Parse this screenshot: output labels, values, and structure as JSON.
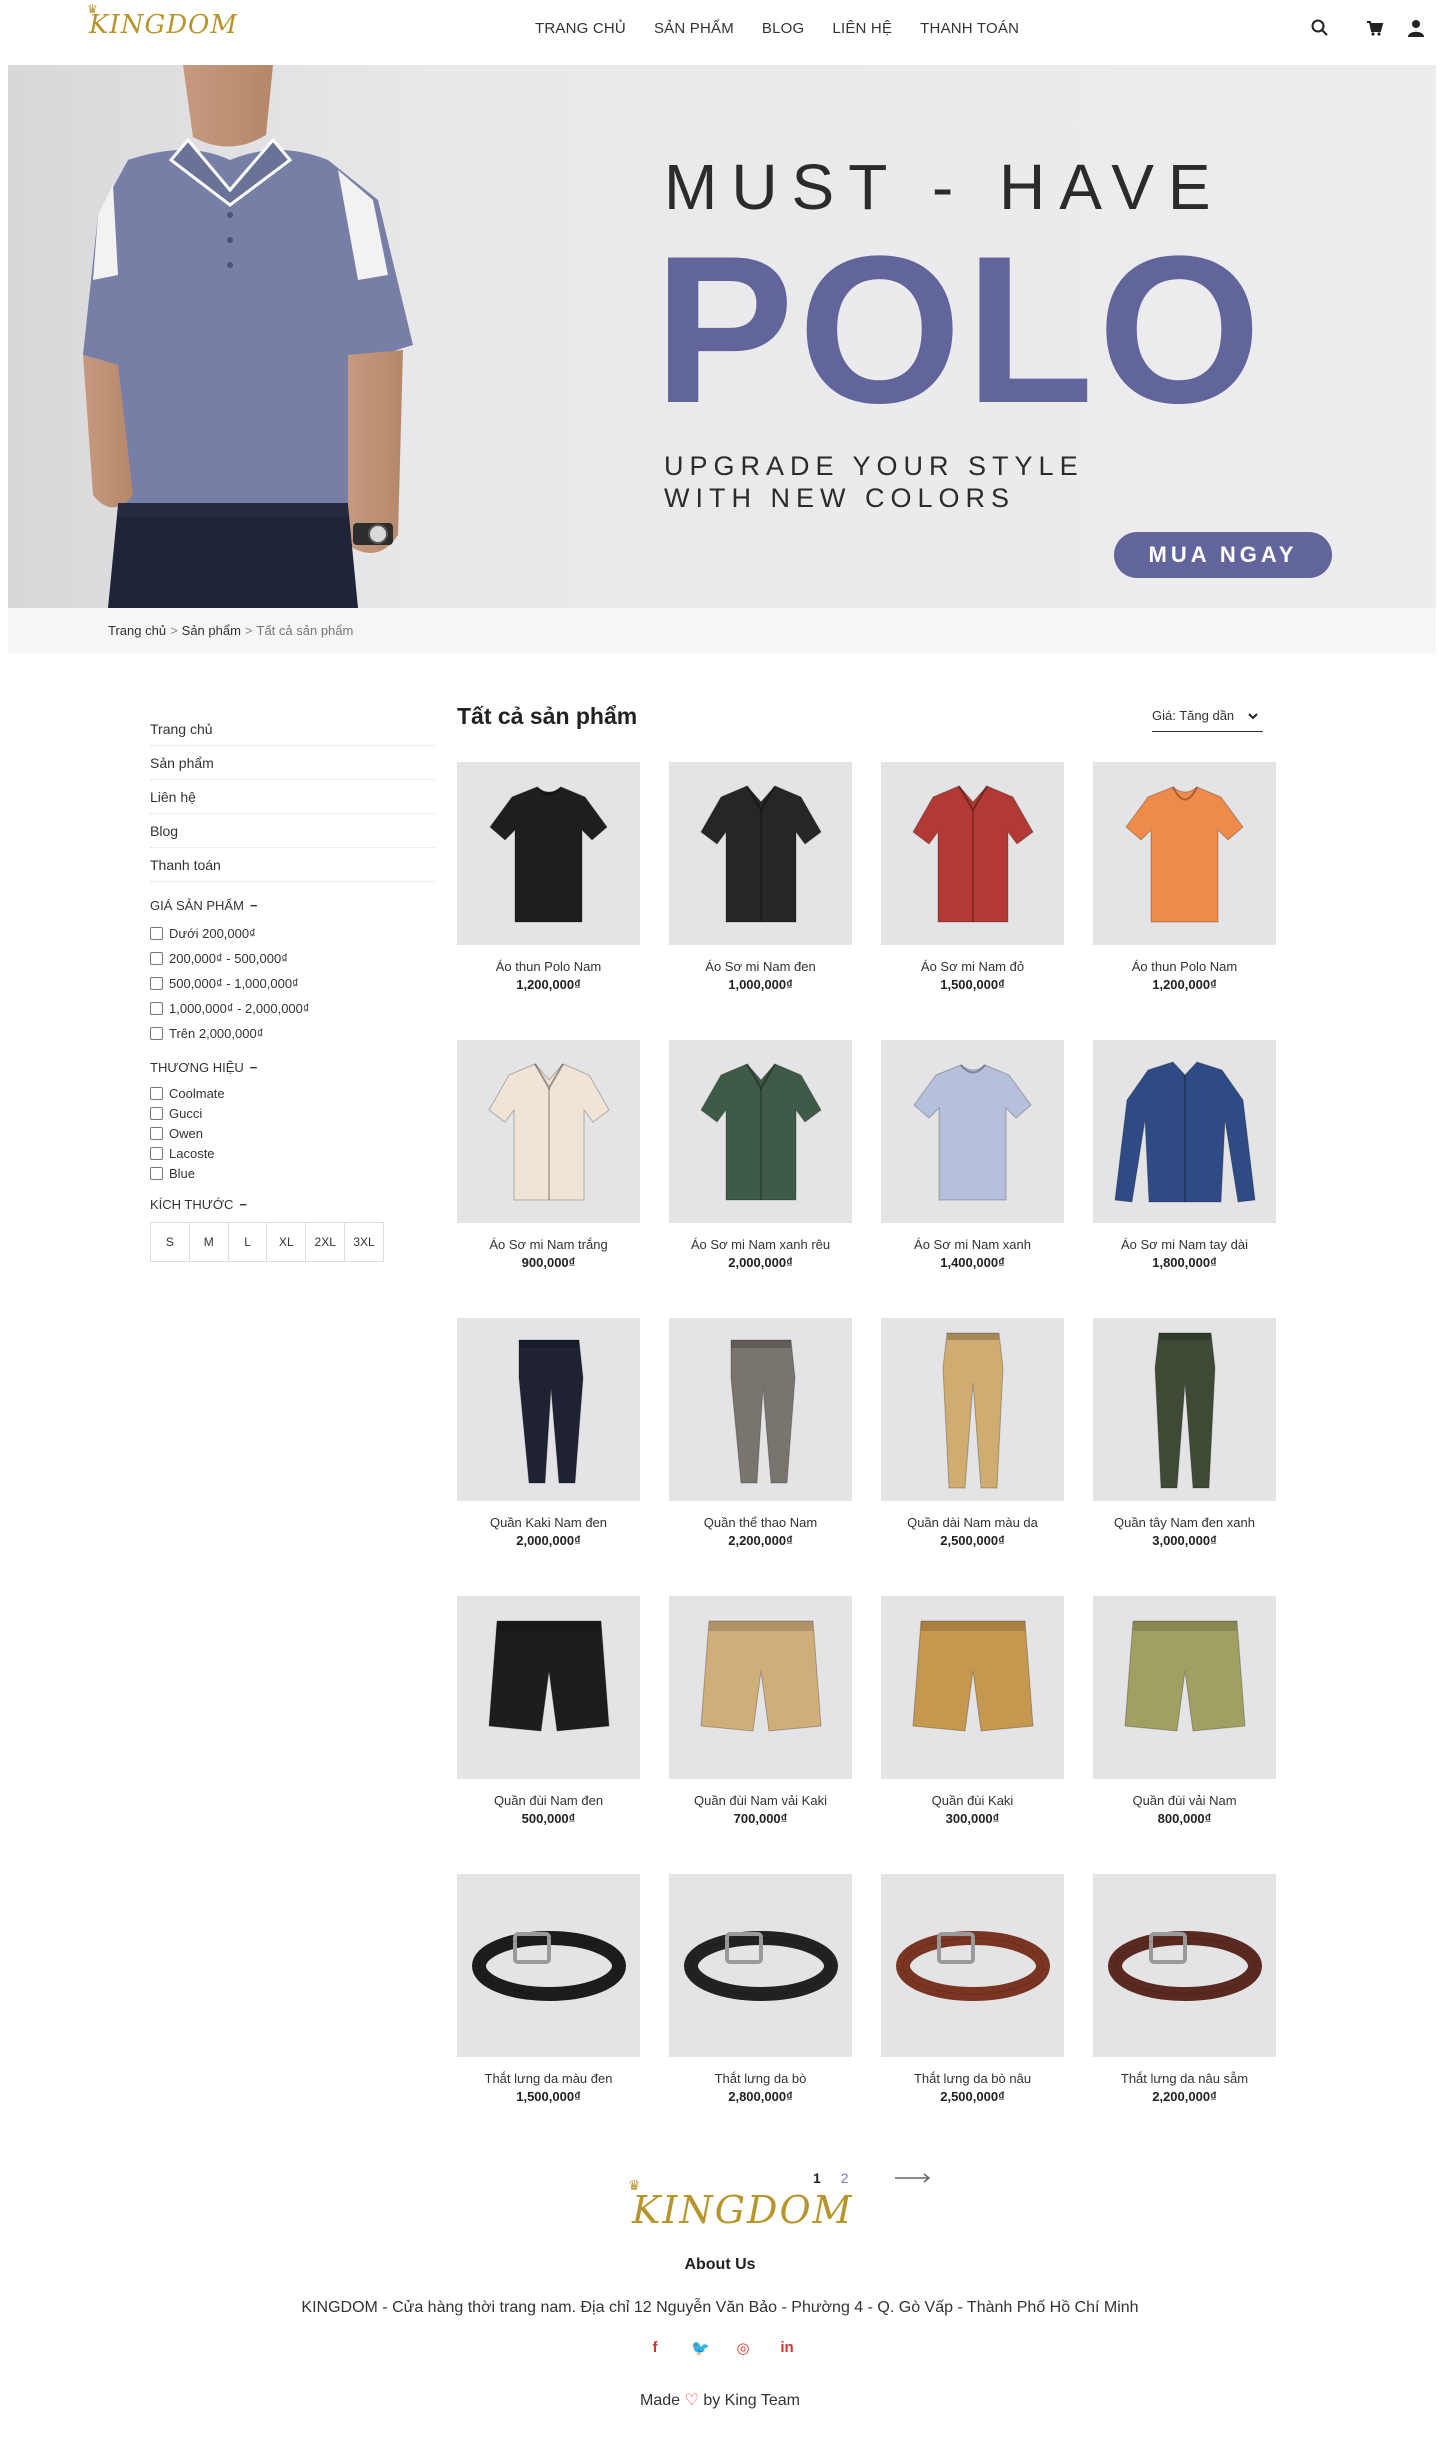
{
  "header": {
    "logo": "KINGDOM",
    "nav": [
      "TRANG CHỦ",
      "SẢN PHẨM",
      "BLOG",
      "LIÊN HỆ",
      "THANH TOÁN"
    ],
    "icons": [
      "search-icon",
      "cart-icon",
      "user-icon"
    ]
  },
  "hero": {
    "line1": "MUST - HAVE",
    "line2": "POLO",
    "line3a": "UPGRADE YOUR STYLE",
    "line3b": "WITH NEW COLORS",
    "button": "MUA NGAY",
    "accent": "#62659b"
  },
  "breadcrumb": {
    "items": [
      "Trang chủ",
      "Sản phẩm",
      "Tất cả sản phẩm"
    ],
    "separator": ">"
  },
  "sidebar": {
    "links": [
      "Trang chủ",
      "Sản phẩm",
      "Liên hệ",
      "Blog",
      "Thanh toán"
    ],
    "price_heading": "GIÁ SẢN PHẨM",
    "prices": [
      "Dưới 200,000₫",
      "200,000₫ - 500,000₫",
      "500,000₫ - 1,000,000₫",
      "1,000,000₫ - 2,000,000₫",
      "Trên 2,000,000₫"
    ],
    "brand_heading": "THƯƠNG HIỆU",
    "brands": [
      "Coolmate",
      "Gucci",
      "Owen",
      "Lacoste",
      "Blue"
    ],
    "size_heading": "KÍCH THƯỚC",
    "sizes": [
      "S",
      "M",
      "L",
      "XL",
      "2XL",
      "3XL"
    ],
    "toggle": "−"
  },
  "main": {
    "title": "Tất cả sản phẩm",
    "sort_label": "Giá: Tăng dần"
  },
  "products": [
    {
      "name": "Áo thun Polo Nam",
      "price": "1,200,000₫",
      "kind": "polo",
      "color": "#1e1e1e"
    },
    {
      "name": "Áo Sơ mi Nam đen",
      "price": "1,000,000₫",
      "kind": "shirt",
      "color": "#262626"
    },
    {
      "name": "Áo Sơ mi Nam đỏ",
      "price": "1,500,000₫",
      "kind": "shirt",
      "color": "#b33a34"
    },
    {
      "name": "Áo thun Polo Nam",
      "price": "1,200,000₫",
      "kind": "tee",
      "color": "#ee8a4a"
    },
    {
      "name": "Áo Sơ mi Nam trắng",
      "price": "900,000₫",
      "kind": "shirt",
      "color": "#efe4d6"
    },
    {
      "name": "Áo Sơ mi Nam xanh rêu",
      "price": "2,000,000₫",
      "kind": "shirt",
      "color": "#3e5b48"
    },
    {
      "name": "Áo Sơ mi Nam xanh",
      "price": "1,400,000₫",
      "kind": "polo",
      "color": "#b6bfdc"
    },
    {
      "name": "Áo Sơ mi Nam tay dài",
      "price": "1,800,000₫",
      "kind": "longshirt",
      "color": "#2f4b86"
    },
    {
      "name": "Quần Kaki Nam đen",
      "price": "2,000,000₫",
      "kind": "jogger",
      "color": "#1f2233"
    },
    {
      "name": "Quần thể thao Nam",
      "price": "2,200,000₫",
      "kind": "jogger",
      "color": "#7a746f"
    },
    {
      "name": "Quần dài Nam màu da",
      "price": "2,500,000₫",
      "kind": "pants",
      "color": "#cfac70"
    },
    {
      "name": "Quần tây Nam đen xanh",
      "price": "3,000,000₫",
      "kind": "pants",
      "color": "#3e4a36"
    },
    {
      "name": "Quần đùi Nam đen",
      "price": "500,000₫",
      "kind": "shorts",
      "color": "#1d1d1d"
    },
    {
      "name": "Quần đùi Nam vải Kaki",
      "price": "700,000₫",
      "kind": "shorts",
      "color": "#cfae7a"
    },
    {
      "name": "Quần đùi Kaki",
      "price": "300,000₫",
      "kind": "shorts",
      "color": "#c6974e"
    },
    {
      "name": "Quần đùi vải Nam",
      "price": "800,000₫",
      "kind": "shorts",
      "color": "#9fa062"
    },
    {
      "name": "Thắt lưng da màu đen",
      "price": "1,500,000₫",
      "kind": "belt",
      "color": "#1c1c1c"
    },
    {
      "name": "Thắt lưng da bò",
      "price": "2,800,000₫",
      "kind": "belt",
      "color": "#222222"
    },
    {
      "name": "Thắt lưng da bò nâu",
      "price": "2,500,000₫",
      "kind": "belt",
      "color": "#7a3522"
    },
    {
      "name": "Thắt lưng da nâu sẫm",
      "price": "2,200,000₫",
      "kind": "belt",
      "color": "#5a2a20"
    }
  ],
  "pagination": {
    "pages": [
      "1",
      "2"
    ],
    "current": "1"
  },
  "footer": {
    "logo": "KINGDOM",
    "about": "About Us",
    "address": "KINGDOM - Cửa hàng thời trang nam. Địa chỉ 12 Nguyễn Văn Bảo - Phường 4 - Q. Gò Vấp - Thành Phố Hồ Chí Minh",
    "social": [
      "facebook-icon",
      "twitter-icon",
      "instagram-icon",
      "linkedin-icon"
    ],
    "social_glyphs": [
      "f",
      "🐦",
      "◎",
      "in"
    ],
    "made_prefix": "Made",
    "made_suffix": "by King Team"
  }
}
